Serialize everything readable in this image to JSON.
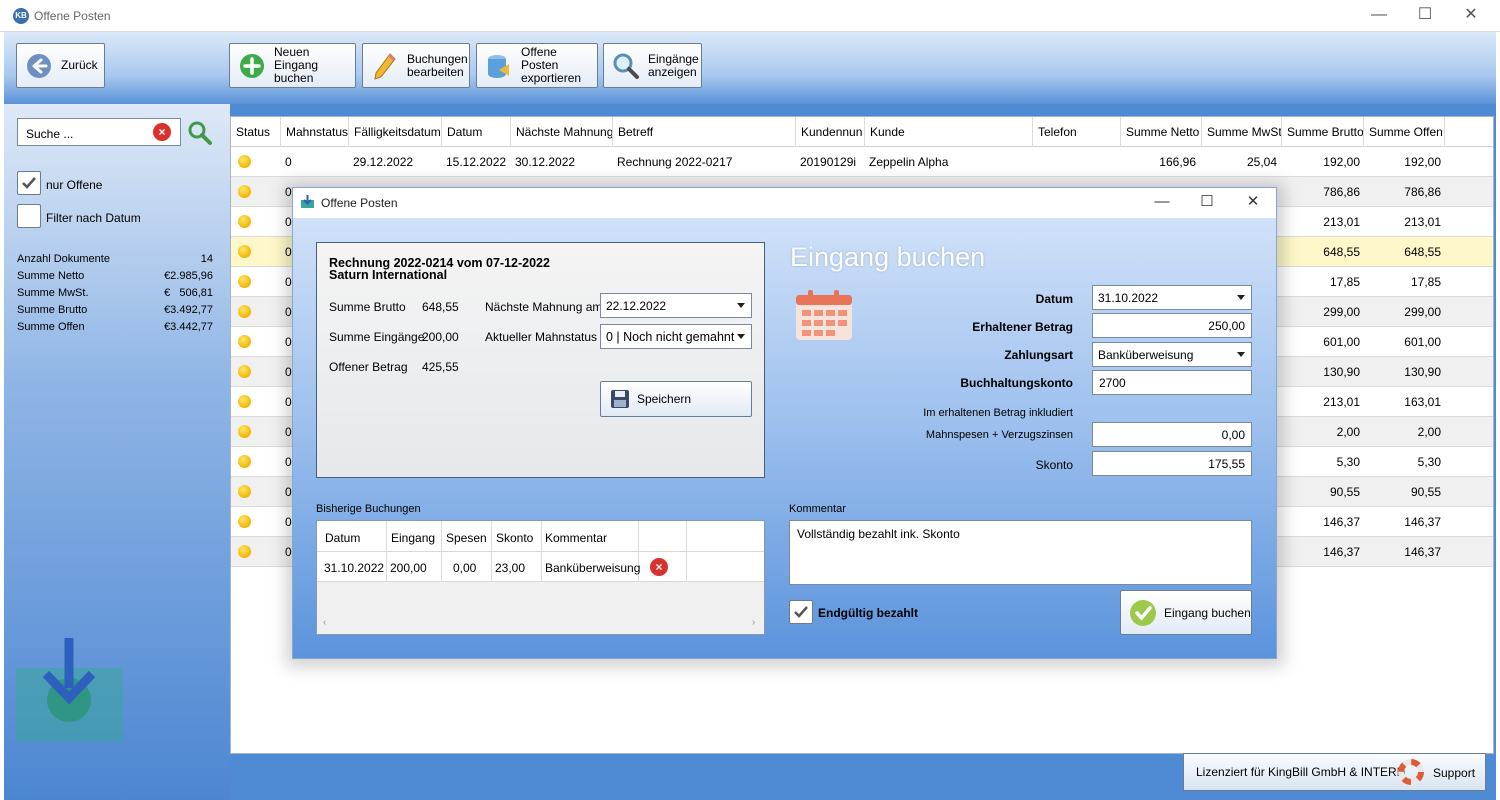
{
  "window": {
    "title": "Offene Posten",
    "icon_text": "KB",
    "min": "—",
    "max": "☐",
    "close": "✕"
  },
  "toolbar": {
    "back": "Zurück",
    "new_entry": [
      "Neuen Eingang",
      "buchen"
    ],
    "edit_bookings": [
      "Buchungen",
      "bearbeiten"
    ],
    "export": [
      "Offene Posten",
      "exportieren"
    ],
    "show_entries": [
      "Eingänge",
      "anzeigen"
    ]
  },
  "sidebar": {
    "search_placeholder": "Suche ...",
    "only_open": "nur Offene",
    "only_open_checked": true,
    "filter_date": "Filter nach Datum",
    "filter_date_checked": false,
    "stats": [
      {
        "label": "Anzahl Dokumente",
        "value": "14"
      },
      {
        "label": "Summe Netto",
        "value": "€2.985,96"
      },
      {
        "label": "Summe MwSt.",
        "value": "€   506,81"
      },
      {
        "label": "Summe Brutto",
        "value": "€3.492,77"
      },
      {
        "label": "Summe Offen",
        "value": "€3.442,77"
      }
    ]
  },
  "table": {
    "headers": [
      "Status",
      "Mahnstatus",
      "Fälligkeitsdatum",
      "Datum",
      "Nächste Mahnung",
      "Betreff",
      "Kundennun",
      "Kunde",
      "Telefon",
      "Summe Netto",
      "Summe MwSt",
      "Summe Brutto",
      "Summe Offen"
    ],
    "rows": [
      {
        "mahn": "0",
        "faellig": "29.12.2022",
        "datum": "15.12.2022",
        "naechste": "30.12.2022",
        "betreff": "Rechnung 2022-0217",
        "kdnr": "20190129i",
        "kunde": "Zeppelin Alpha",
        "netto": "166,96",
        "mwst": "25,04",
        "brutto": "192,00",
        "offen": "192,00"
      },
      {
        "mahn": "0",
        "faellig": "",
        "datum": "",
        "naechste": "",
        "betreff": "",
        "kdnr": "",
        "kunde": "",
        "netto": "",
        "mwst": "",
        "brutto": "786,86",
        "offen": "786,86"
      },
      {
        "mahn": "0",
        "faellig": "",
        "datum": "",
        "naechste": "",
        "betreff": "",
        "kdnr": "",
        "kunde": "",
        "netto": "",
        "mwst": "",
        "brutto": "213,01",
        "offen": "213,01"
      },
      {
        "mahn": "0",
        "faellig": "",
        "datum": "",
        "naechste": "",
        "betreff": "",
        "kdnr": "",
        "kunde": "",
        "netto": "",
        "mwst": "",
        "brutto": "648,55",
        "offen": "648,55"
      },
      {
        "mahn": "0",
        "faellig": "",
        "datum": "",
        "naechste": "",
        "betreff": "",
        "kdnr": "",
        "kunde": "",
        "netto": "",
        "mwst": "",
        "brutto": "17,85",
        "offen": "17,85"
      },
      {
        "mahn": "0",
        "faellig": "",
        "datum": "",
        "naechste": "",
        "betreff": "",
        "kdnr": "",
        "kunde": "",
        "netto": "",
        "mwst": "",
        "brutto": "299,00",
        "offen": "299,00"
      },
      {
        "mahn": "0",
        "faellig": "",
        "datum": "",
        "naechste": "",
        "betreff": "",
        "kdnr": "",
        "kunde": "",
        "netto": "",
        "mwst": "",
        "brutto": "601,00",
        "offen": "601,00"
      },
      {
        "mahn": "0",
        "faellig": "",
        "datum": "",
        "naechste": "",
        "betreff": "",
        "kdnr": "",
        "kunde": "",
        "netto": "",
        "mwst": "",
        "brutto": "130,90",
        "offen": "130,90"
      },
      {
        "mahn": "0",
        "faellig": "",
        "datum": "",
        "naechste": "",
        "betreff": "",
        "kdnr": "",
        "kunde": "",
        "netto": "",
        "mwst": "",
        "brutto": "213,01",
        "offen": "163,01"
      },
      {
        "mahn": "0",
        "faellig": "",
        "datum": "",
        "naechste": "",
        "betreff": "",
        "kdnr": "",
        "kunde": "",
        "netto": "",
        "mwst": "",
        "brutto": "2,00",
        "offen": "2,00"
      },
      {
        "mahn": "0",
        "faellig": "",
        "datum": "",
        "naechste": "",
        "betreff": "",
        "kdnr": "",
        "kunde": "",
        "netto": "",
        "mwst": "",
        "brutto": "5,30",
        "offen": "5,30"
      },
      {
        "mahn": "0",
        "faellig": "",
        "datum": "",
        "naechste": "",
        "betreff": "",
        "kdnr": "",
        "kunde": "",
        "netto": "",
        "mwst": "",
        "brutto": "90,55",
        "offen": "90,55"
      },
      {
        "mahn": "0",
        "faellig": "",
        "datum": "",
        "naechste": "",
        "betreff": "",
        "kdnr": "",
        "kunde": "",
        "netto": "",
        "mwst": "",
        "brutto": "146,37",
        "offen": "146,37"
      },
      {
        "mahn": "0",
        "faellig": "",
        "datum": "",
        "naechste": "",
        "betreff": "",
        "kdnr": "",
        "kunde": "",
        "netto": "",
        "mwst": "",
        "brutto": "146,37",
        "offen": "146,37"
      }
    ],
    "highlight_color": "#fdf7c9",
    "alt_color": "#f0f0f0"
  },
  "dialog": {
    "title": "Offene Posten",
    "invoice_title": "Rechnung 2022-0214 vom 07-12-2022",
    "customer": "Saturn International",
    "brutto_label": "Summe Brutto",
    "brutto": "648,55",
    "eingaenge_label": "Summe Eingänge",
    "eingaenge": "200,00",
    "offen_label": "Offener Betrag",
    "offen": "425,55",
    "next_dunning_label": "Nächste Mahnung am",
    "next_dunning": "22.12.2022",
    "dunning_status_label": "Aktueller Mahnstatus",
    "dunning_status": "0 | Noch nicht gemahnt",
    "save": "Speichern",
    "heading": "Eingang buchen",
    "datum_label": "Datum",
    "datum": "31.10.2022",
    "betrag_label": "Erhaltener Betrag",
    "betrag": "250,00",
    "zahlungsart_label": "Zahlungsart",
    "zahlungsart": "Banküberweisung",
    "konto_label": "Buchhaltungskonto",
    "konto": "2700",
    "inkl_label": "Im erhaltenen Betrag inkludiert",
    "spesen_label": "Mahnspesen + Verzugszinsen",
    "spesen": "0,00",
    "skonto_label": "Skonto",
    "skonto": "175,55",
    "history_label": "Bisherige Buchungen",
    "history_headers": [
      "Datum",
      "Eingang",
      "Spesen",
      "Skonto",
      "Kommentar"
    ],
    "history_rows": [
      {
        "datum": "31.10.2022",
        "eingang": "200,00",
        "spesen": "0,00",
        "skonto": "23,00",
        "kommentar": "Banküberweisung"
      }
    ],
    "comment_label": "Kommentar",
    "comment": "Vollständig bezahlt ink. Skonto",
    "paid_label": "Endgültig bezahlt",
    "paid_checked": true,
    "submit": "Eingang buchen"
  },
  "footer": {
    "license": "Lizenziert für KingBill GmbH & INTERN",
    "support": "Support"
  }
}
